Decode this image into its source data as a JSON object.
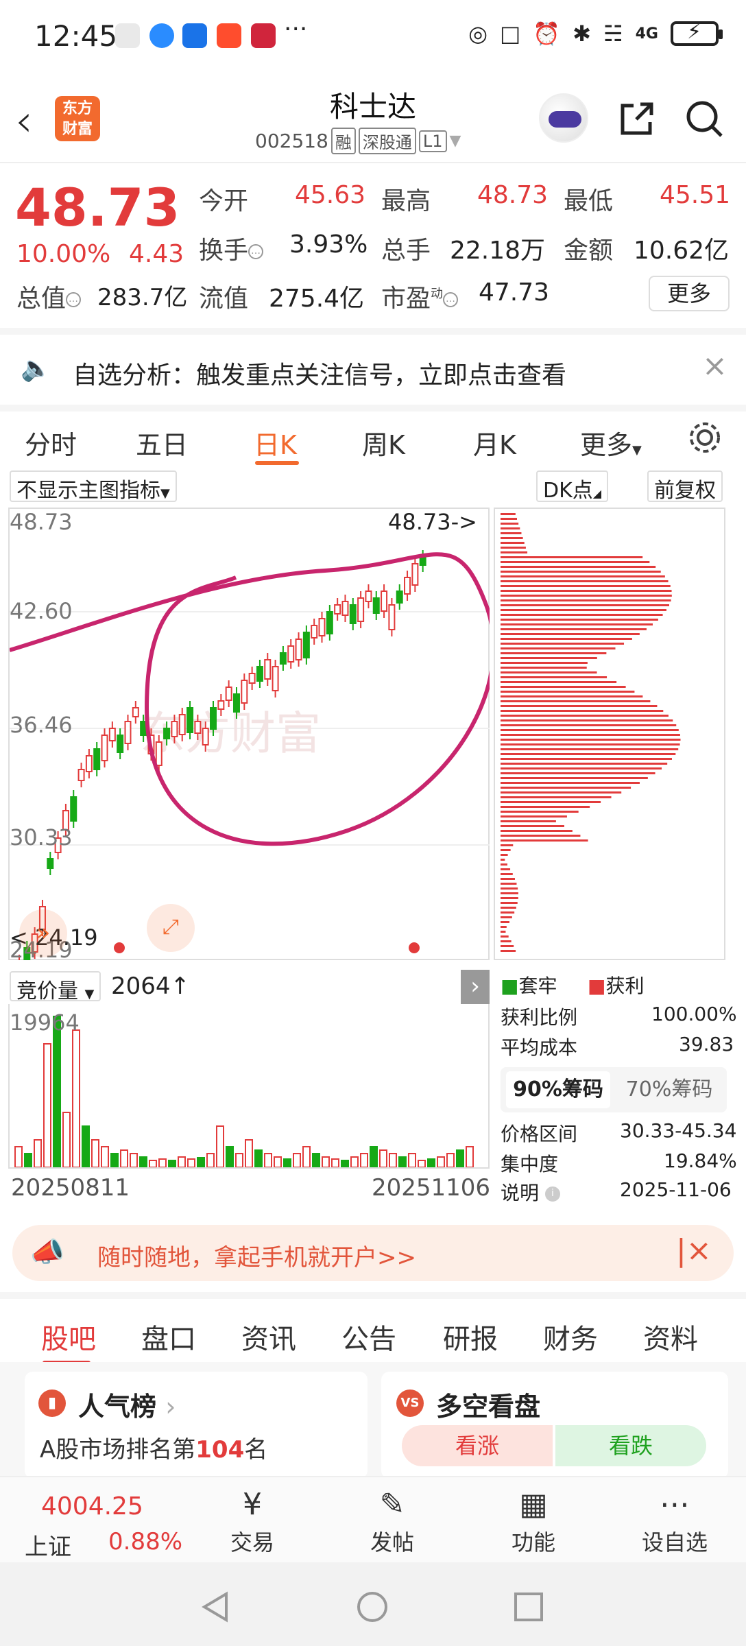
{
  "status": {
    "time": "12:45",
    "dots": "···",
    "network": "4G",
    "colors": {
      "app1": "#d9d9d9",
      "app2": "#2a8cff",
      "app3": "#1a73e8",
      "app4": "#ff4d2d",
      "app5": "#d0253c"
    }
  },
  "header": {
    "logo_line1": "东方",
    "logo_line2": "财富",
    "title": "科士达",
    "code": "002518",
    "tags": [
      "融",
      "深股通",
      "L1"
    ]
  },
  "quote": {
    "price": "48.73",
    "pct": "10.00%",
    "change": "4.43",
    "open_label": "今开",
    "open": "45.63",
    "high_label": "最高",
    "high": "48.73",
    "low_label": "最低",
    "low": "45.51",
    "turnover_label": "换手",
    "turnover": "3.93%",
    "volume_label": "总手",
    "volume": "22.18万",
    "amount_label": "金额",
    "amount": "10.62亿",
    "mktcap_label": "总值",
    "mktcap": "283.7亿",
    "float_label": "流值",
    "float": "275.4亿",
    "pe_label": "市盈",
    "pe_sup": "动",
    "pe": "47.73",
    "more": "更多"
  },
  "alert": {
    "text": "自选分析：触发重点关注信号，立即点击查看"
  },
  "ktabs": [
    "分时",
    "五日",
    "日K",
    "周K",
    "月K",
    "更多"
  ],
  "chart_toolbar": {
    "indicator": "不显示主图指标",
    "dk": "DK点",
    "adjust": "前复权"
  },
  "chart": {
    "y_labels": [
      "48.73",
      "42.60",
      "36.46",
      "30.33",
      "24.19"
    ],
    "last_label": "48.73->",
    "low_label": "24.19",
    "watermark": "东方财富"
  },
  "volume": {
    "selector": "竞价量",
    "value": "2064",
    "max_label": "19964",
    "start_date": "20250811",
    "end_date": "20251106"
  },
  "chip": {
    "legend_locked": "套牢",
    "legend_profit": "获利",
    "profit_ratio_label": "获利比例",
    "profit_ratio": "100.00%",
    "avg_cost_label": "平均成本",
    "avg_cost": "39.83",
    "tab_90": "90%筹码",
    "tab_70": "70%筹码",
    "range_label": "价格区间",
    "range": "30.33-45.34",
    "concentration_label": "集中度",
    "concentration": "19.84%",
    "note_label": "说明",
    "note_date": "2025-11-06"
  },
  "banner": {
    "text": "随时随地，拿起手机就开户>>"
  },
  "btabs": [
    "股吧",
    "盘口",
    "资讯",
    "公告",
    "研报",
    "财务",
    "资料"
  ],
  "cards": {
    "left_title": "人气榜",
    "left_sub_prefix": "A股市场排名第",
    "left_sub_rank": "104",
    "left_sub_suffix": "名",
    "right_title": "多空看盘",
    "up": "看涨",
    "down": "看跌"
  },
  "bottomnav": {
    "index_value": "4004.25",
    "index_name": "上证",
    "index_pct": "0.88%",
    "items": [
      "交易",
      "发帖",
      "功能",
      "设自选"
    ]
  }
}
